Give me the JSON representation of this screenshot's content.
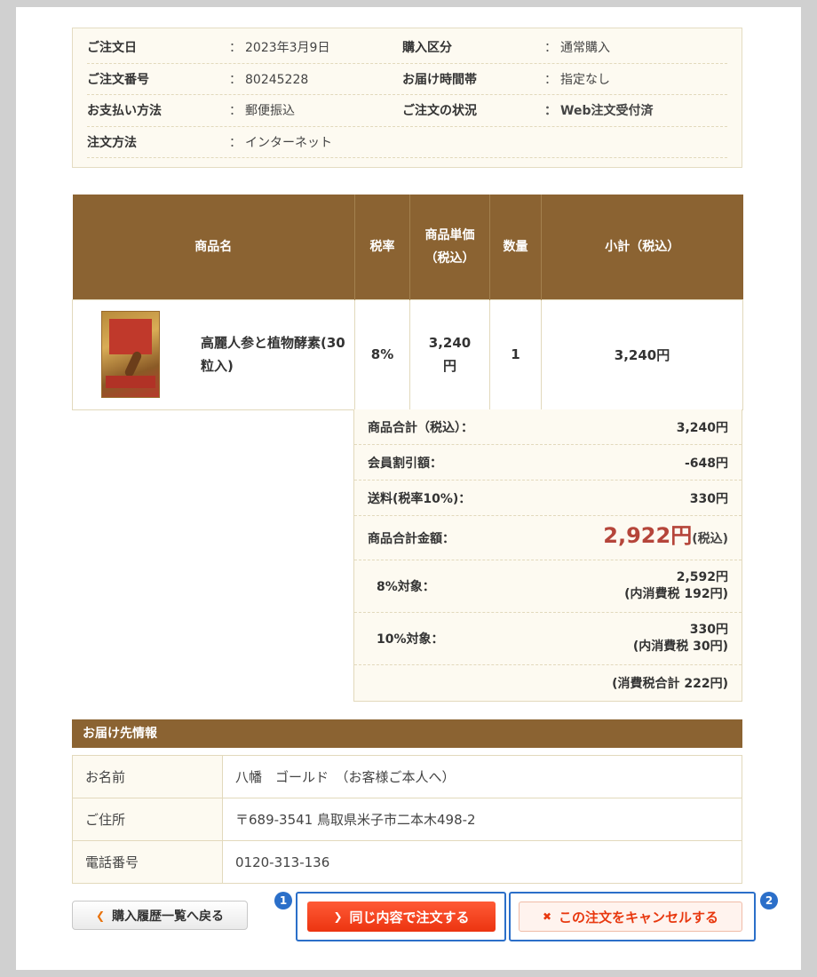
{
  "order_info": {
    "rows": [
      {
        "l1": "ご注文日",
        "v1": "2023年3月9日",
        "l2": "購入区分",
        "v2": "通常購入"
      },
      {
        "l1": "ご注文番号",
        "v1": "80245228",
        "l2": "お届け時間帯",
        "v2": "指定なし"
      },
      {
        "l1": "お支払い方法",
        "v1": "郵便振込",
        "l2": "ご注文の状況",
        "v2": "Web注文受付済"
      },
      {
        "l1": "注文方法",
        "v1": "インターネット"
      }
    ]
  },
  "product_table": {
    "headers": {
      "name": "商品名",
      "tax_rate": "税率",
      "unit_price": "商品単価（税込）",
      "quantity": "数量",
      "subtotal": "小計（税込）"
    },
    "item": {
      "name": "高麗人参と植物酵素(30粒入)",
      "tax_rate": "8%",
      "unit_price": "3,240円",
      "quantity": "1",
      "subtotal": "3,240円"
    }
  },
  "summary": {
    "goods_total_label": "商品合計（税込）：",
    "goods_total_value": "3,240円",
    "discount_label": "会員割引額：",
    "discount_value": "-648円",
    "shipping_label": "送料(税率10%)：",
    "shipping_value": "330円",
    "grand_total_label": "商品合計金額：",
    "grand_total_value": "2,922円",
    "grand_total_suffix": "(税込)",
    "tax8_label": "8%対象：",
    "tax8_amount": "2,592円",
    "tax8_tax": "(内消費税 192円)",
    "tax10_label": "10%対象：",
    "tax10_amount": "330円",
    "tax10_tax": "(内消費税 30円)",
    "tax_total": "(消費税合計 222円)"
  },
  "delivery": {
    "title": "お届け先情報",
    "name_label": "お名前",
    "name_value": "八幡　ゴールド　（お客様ご本人へ）",
    "address_label": "ご住所",
    "address_value": "〒689-3541 鳥取県米子市二本木498-2",
    "phone_label": "電話番号",
    "phone_value": "0120-313-136"
  },
  "buttons": {
    "back": "購入履歴一覧へ戻る",
    "reorder": "同じ内容で注文する",
    "cancel": "この注文をキャンセルする",
    "badge1": "1",
    "badge2": "2"
  },
  "colors": {
    "header_brown": "#8b6332",
    "accent_orange": "#e8720c",
    "total_red": "#b5453a",
    "reorder_red": "#ec3410",
    "annotation_blue": "#2b6fc9"
  }
}
